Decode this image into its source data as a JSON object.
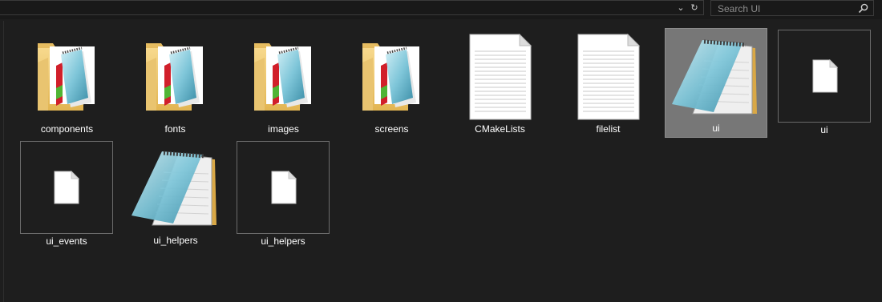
{
  "toolbar": {
    "dropdown_glyph": "⌄",
    "refresh_glyph": "↻",
    "search_placeholder": "Search UI"
  },
  "items": [
    {
      "label": "components",
      "type": "folder"
    },
    {
      "label": "fonts",
      "type": "folder"
    },
    {
      "label": "images",
      "type": "folder"
    },
    {
      "label": "screens",
      "type": "folder"
    },
    {
      "label": "CMakeLists",
      "type": "text-document"
    },
    {
      "label": "filelist",
      "type": "text-document"
    },
    {
      "label": "ui",
      "type": "notepad",
      "selected": true
    },
    {
      "label": "ui",
      "type": "blank-file"
    },
    {
      "label": "ui_events",
      "type": "blank-file"
    },
    {
      "label": "ui_helpers",
      "type": "notepad"
    },
    {
      "label": "ui_helpers",
      "type": "blank-file"
    }
  ],
  "colors": {
    "background": "#1e1e1e",
    "selection": "#777777",
    "folder": "#f0c873"
  }
}
